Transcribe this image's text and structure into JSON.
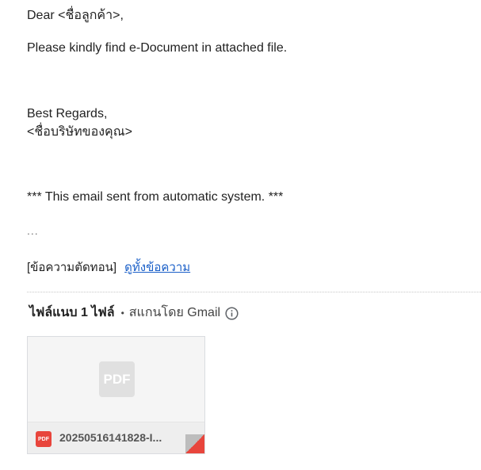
{
  "email": {
    "greeting": "Dear <ชื่อลูกค้า>,",
    "intro": "Please kindly find e-Document in attached file.",
    "regards": "Best Regards,",
    "company": "<ชื่อบริษัทของคุณ>",
    "notice": "*** This email sent from automatic system. ***",
    "ellipsis": "...",
    "trimmed_label": "[ข้อความตัดทอน]",
    "view_full_link": "ดูทั้งข้อความ"
  },
  "attachments": {
    "count_label": "ไฟล์แนบ 1 ไฟล์",
    "separator": "•",
    "scanned_label": "สแกนโดย Gmail",
    "info_icon": "info-icon",
    "files": [
      {
        "preview_label": "PDF",
        "type_badge": "PDF",
        "name": "20250516141828-I...",
        "badge_color": "#e8453c"
      }
    ]
  },
  "colors": {
    "link": "#1a5fc8",
    "text": "#222222",
    "pdf_red": "#e8453c"
  }
}
